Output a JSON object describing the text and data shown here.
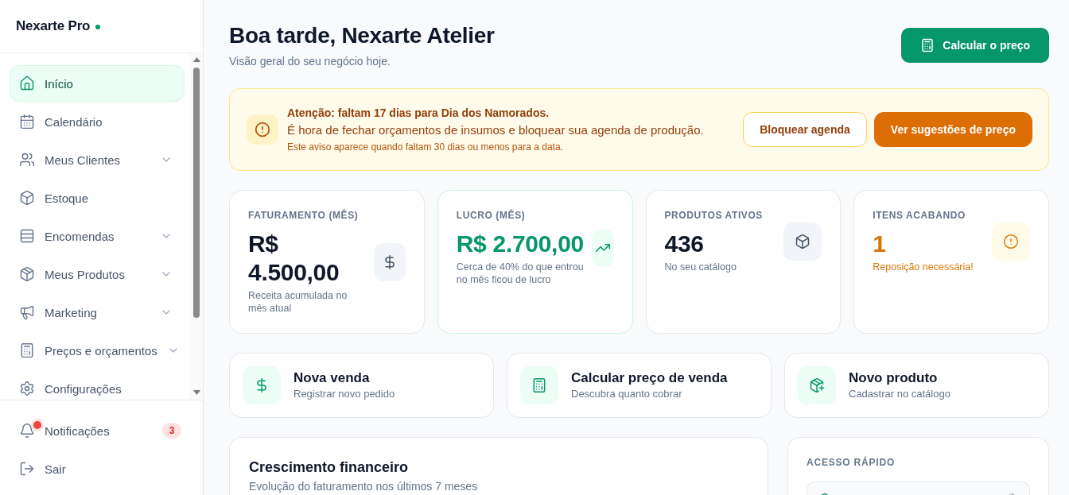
{
  "sidebar": {
    "brand": "Nexarte Pro",
    "items": [
      {
        "label": "Início",
        "selected": true,
        "has_submenu": false
      },
      {
        "label": "Calendário",
        "selected": false,
        "has_submenu": false
      },
      {
        "label": "Meus Clientes",
        "selected": false,
        "has_submenu": true
      },
      {
        "label": "Estoque",
        "selected": false,
        "has_submenu": false
      },
      {
        "label": "Encomendas",
        "selected": false,
        "has_submenu": true
      },
      {
        "label": "Meus Produtos",
        "selected": false,
        "has_submenu": true
      },
      {
        "label": "Marketing",
        "selected": false,
        "has_submenu": true
      },
      {
        "label": "Preços e orçamentos",
        "selected": false,
        "has_submenu": true
      },
      {
        "label": "Configurações",
        "selected": false,
        "has_submenu": false
      }
    ],
    "footer_items": [
      {
        "label": "Notificações",
        "badge": "3",
        "alert_dot": true
      },
      {
        "label": "Sair",
        "alert_dot": false
      }
    ]
  },
  "header": {
    "title": "Boa tarde, Nexarte Atelier",
    "subtitle": "Visão geral do seu negócio hoje.",
    "action": {
      "label": "Calcular o preço"
    }
  },
  "alert": {
    "title": "Atenção: faltam 17 dias para Dia dos Namorados.",
    "message": "É hora de fechar orçamentos de insumos e bloquear sua agenda de produção.",
    "note": "Este aviso aparece quando faltam 30 dias ou menos para a data.",
    "buttons": [
      {
        "label": "Bloquear agenda",
        "kind": "secondary"
      },
      {
        "label": "Ver sugestões de preço",
        "kind": "primary"
      }
    ]
  },
  "stats": [
    {
      "label": "FATURAMENTO (MÊS)",
      "value": "R$ 4.500,00",
      "note": "Receita acumulada no mês atual",
      "kind": "neutral"
    },
    {
      "label": "LUCRO (MÊS)",
      "value": "R$ 2.700,00",
      "note": "Cerca de 40% do que entrou no mês ficou de lucro",
      "kind": "positive"
    },
    {
      "label": "PRODUTOS ATIVOS",
      "value": "436",
      "note": "No seu catálogo",
      "kind": "neutral"
    },
    {
      "label": "ITENS ACABANDO",
      "value": "1",
      "note": "Reposição necessária!",
      "kind": "warning"
    }
  ],
  "actions": [
    {
      "title": "Nova venda",
      "subtitle": "Registrar novo pedido"
    },
    {
      "title": "Calcular preço de venda",
      "subtitle": "Descubra quanto cobrar"
    },
    {
      "title": "Novo produto",
      "subtitle": "Cadastrar no catálogo"
    }
  ],
  "growth_card": {
    "title": "Crescimento financeiro",
    "subtitle": "Evolução do faturamento nos últimos 7 meses"
  },
  "quick_access": {
    "title": "ACESSO RÁPIDO"
  }
}
